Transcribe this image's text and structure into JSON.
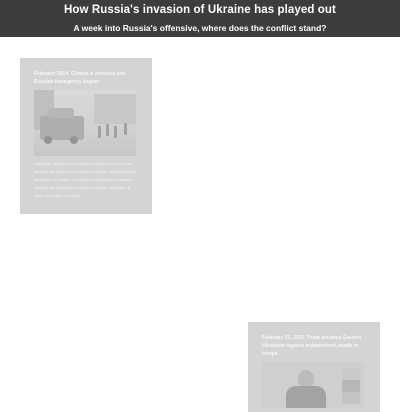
{
  "header": {
    "title": "How Russia's invasion of Ukraine has played out",
    "subtitle": "A week into Russia's offensive, where does the conflict stand?"
  },
  "timeline": [
    {
      "heading": "February 2014: Crimea is annexed and Russian insurgency begins",
      "body": "Following Ukraine's pro-western movement in 2014 that brought into power a pro-western regime, Putin seized the peninsula of Crimea. Pro-Russian insurgents in eastern Ukraine are funded and armed by Russia, leading to 8 years of conflict in Donbas.",
      "image_icon": "military-vehicle-photo"
    },
    {
      "heading": "February 21, 2022: Putin declares Eastern Ukrainian regions independent, sends in troops",
      "image_icon": "putin-portrait-photo"
    }
  ],
  "colors": {
    "header_bg": "#3d3d3d",
    "header_text": "#ffffff",
    "card_bg": "#d2d2d2",
    "page_bg": "#ffffff"
  }
}
